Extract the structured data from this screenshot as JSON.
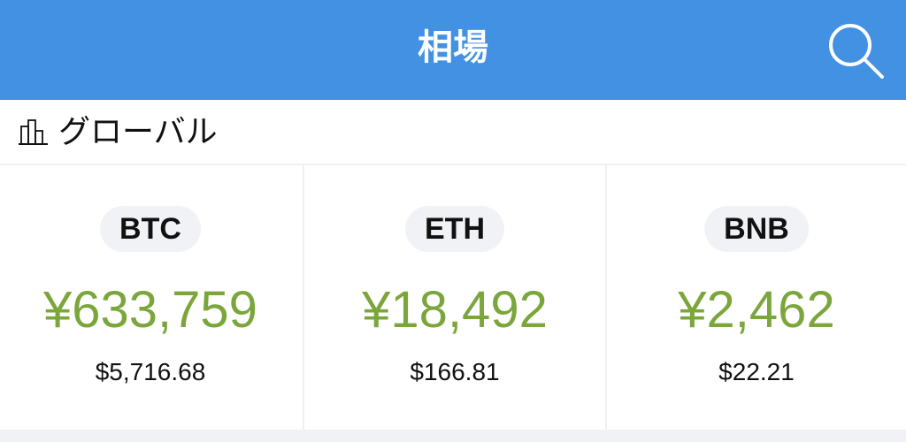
{
  "header": {
    "title": "相場",
    "search_icon": "search-icon"
  },
  "section": {
    "icon": "bar-chart-icon",
    "label": "グローバル"
  },
  "tickers": [
    {
      "symbol": "BTC",
      "jpy_price": "¥633,759",
      "usd_price": "$5,716.68"
    },
    {
      "symbol": "ETH",
      "jpy_price": "¥18,492",
      "usd_price": "$166.81"
    },
    {
      "symbol": "BNB",
      "jpy_price": "¥2,462",
      "usd_price": "$22.21"
    }
  ],
  "colors": {
    "header_bg": "#4391e3",
    "price_green": "#7aa63b",
    "pill_bg": "#f1f2f5",
    "divider": "#eef0f3"
  }
}
